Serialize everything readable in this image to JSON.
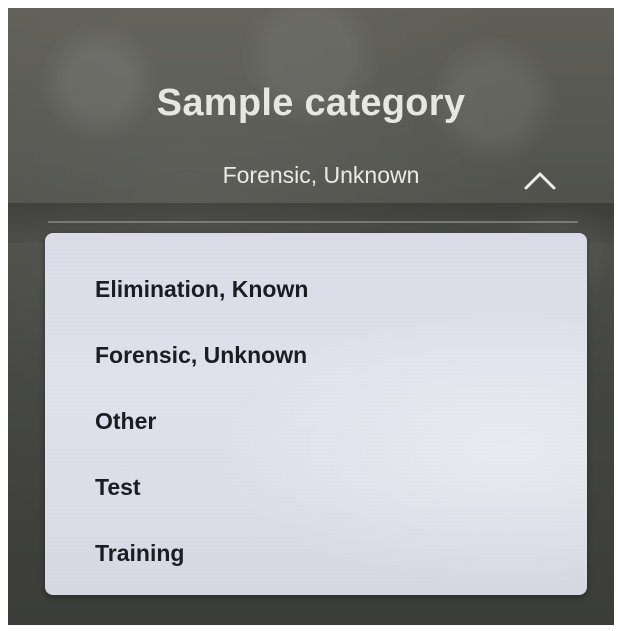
{
  "header": {
    "title": "Sample category"
  },
  "select": {
    "selected_value": "Forensic, Unknown",
    "icon": "chevron-up-icon",
    "expanded": true
  },
  "dropdown": {
    "options": [
      {
        "label": "Elimination, Known"
      },
      {
        "label": "Forensic, Unknown"
      },
      {
        "label": "Other"
      },
      {
        "label": "Test"
      },
      {
        "label": "Training"
      }
    ]
  },
  "colors": {
    "background": "#4c4d47",
    "title_text": "#e7e7e2",
    "dropdown_bg": "#dfe0ea",
    "option_text": "#1c1d22"
  }
}
